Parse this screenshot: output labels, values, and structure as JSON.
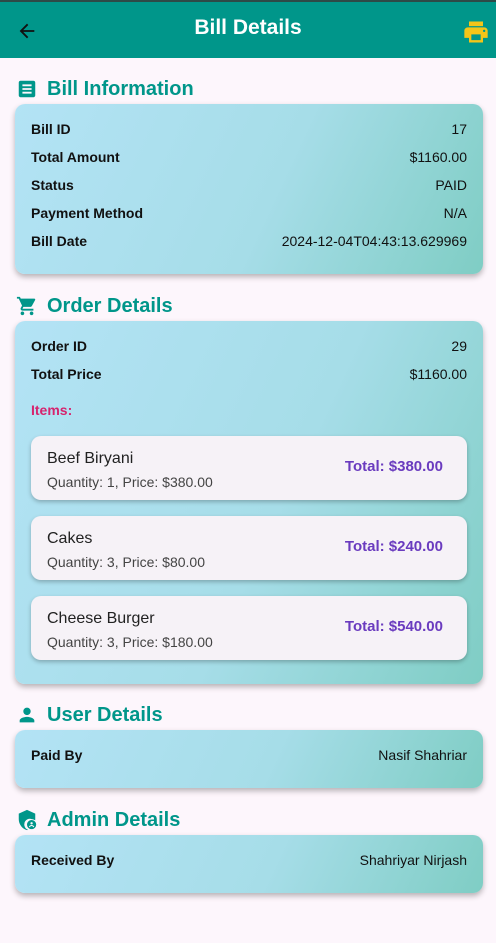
{
  "appbar": {
    "title": "Bill Details"
  },
  "bill_info": {
    "heading": "Bill Information",
    "rows": [
      {
        "label": "Bill ID",
        "value": "17"
      },
      {
        "label": "Total Amount",
        "value": "$1160.00"
      },
      {
        "label": "Status",
        "value": "PAID"
      },
      {
        "label": "Payment Method",
        "value": "N/A"
      },
      {
        "label": "Bill Date",
        "value": "2024-12-04T04:43:13.629969"
      }
    ]
  },
  "order": {
    "heading": "Order Details",
    "rows": [
      {
        "label": "Order ID",
        "value": "29"
      },
      {
        "label": "Total Price",
        "value": "$1160.00"
      }
    ],
    "items_label": "Items:",
    "items": [
      {
        "name": "Beef Biryani",
        "detail": "Quantity: 1, Price: $380.00",
        "total": "Total: $380.00"
      },
      {
        "name": "Cakes",
        "detail": "Quantity: 3, Price: $80.00",
        "total": "Total: $240.00"
      },
      {
        "name": "Cheese Burger",
        "detail": "Quantity: 3, Price: $180.00",
        "total": "Total: $540.00"
      }
    ]
  },
  "user": {
    "heading": "User Details",
    "rows": [
      {
        "label": "Paid By",
        "value": "Nasif Shahriar"
      }
    ]
  },
  "admin": {
    "heading": "Admin Details",
    "rows": [
      {
        "label": "Received By",
        "value": "Shahriyar Nirjash"
      }
    ]
  },
  "colors": {
    "primary": "#00968a",
    "items_label": "#d6246e",
    "item_total": "#6a3bbf",
    "printer_icon": "#f5c518"
  },
  "icons": {
    "back": "arrow-left-icon",
    "print": "printer-icon",
    "bill": "receipt-icon",
    "order": "shopping-cart-icon",
    "user": "person-icon",
    "admin": "admin-shield-icon"
  }
}
